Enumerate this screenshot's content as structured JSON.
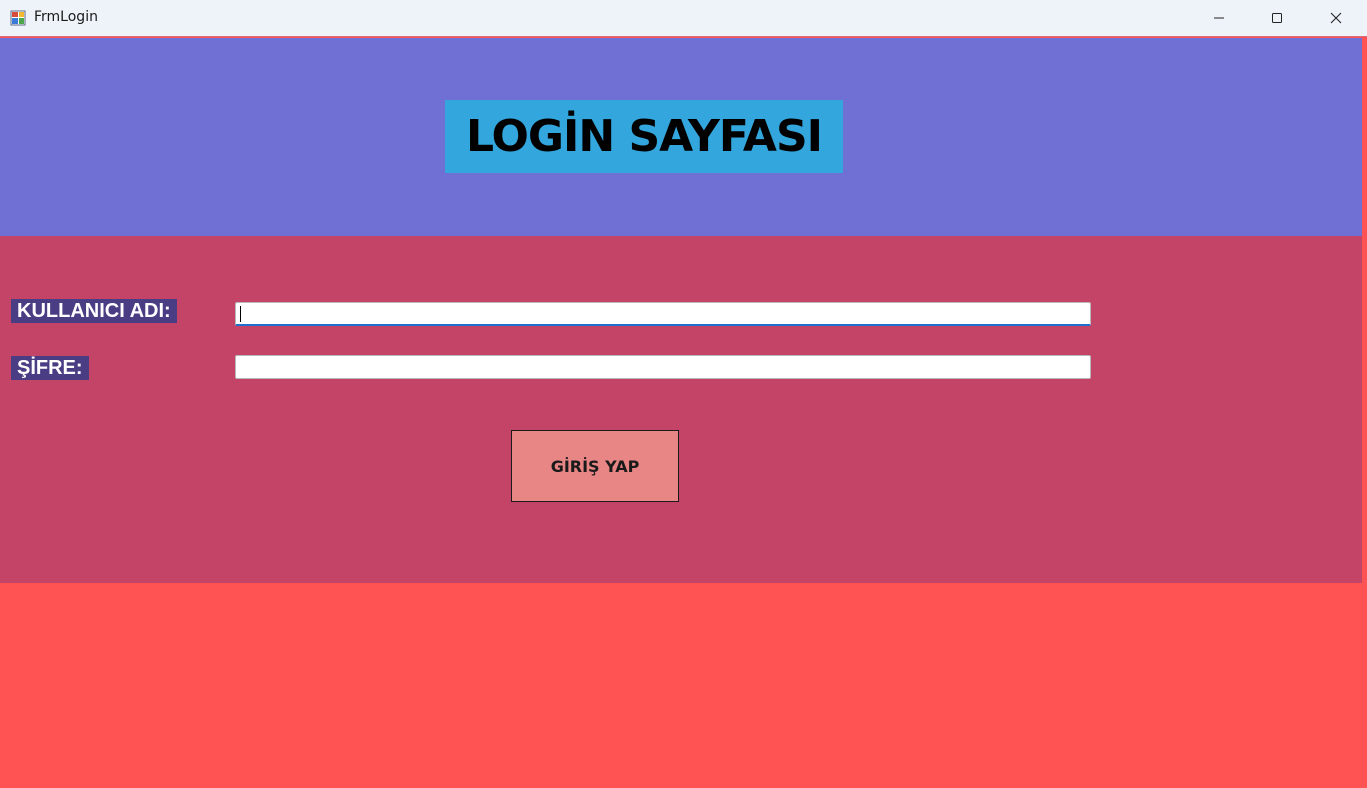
{
  "window": {
    "title": "FrmLogin",
    "controls": {
      "minimize_icon": "minimize-icon",
      "maximize_icon": "maximize-icon",
      "close_icon": "close-icon"
    }
  },
  "header": {
    "title": "LOGİN SAYFASI",
    "background": "#33a6dd"
  },
  "form": {
    "username_label": "KULLANICI ADI:",
    "username_value": "",
    "password_label": "ŞİFRE:",
    "password_value": "",
    "submit_label": "GİRİŞ YAP"
  },
  "colors": {
    "top_panel": "#7070d4",
    "middle_panel": "#c44468",
    "bottom_panel": "#ff5252",
    "label_background": "#4a3d84",
    "button_background": "#e88585"
  }
}
